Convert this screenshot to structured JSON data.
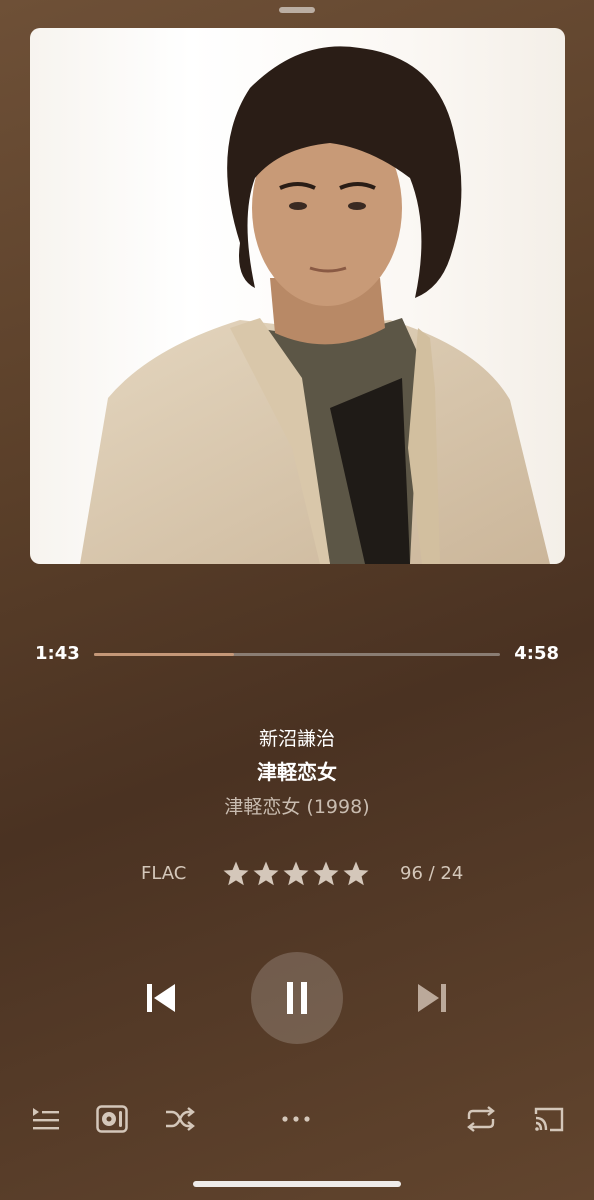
{
  "now_playing": {
    "elapsed": "1:43",
    "duration": "4:58",
    "progress_fraction": 0.345,
    "artist": "新沼謙治",
    "title": "津軽恋女",
    "album": "津軽恋女 (1998)",
    "format": "FLAC",
    "rating_stars": 5,
    "counts": "96 / 24"
  },
  "colors": {
    "progress_fill": "#c59878",
    "progress_track": "#8a7d73",
    "star": "#d4c7ba"
  },
  "icons": {
    "grabber": "grab-handle",
    "previous": "skip-previous-icon",
    "pause": "pause-icon",
    "next": "skip-next-icon",
    "queue": "queue-list-icon",
    "output": "speaker-output-icon",
    "shuffle": "shuffle-icon",
    "more": "more-icon",
    "repeat": "repeat-icon",
    "cast": "cast-icon"
  }
}
